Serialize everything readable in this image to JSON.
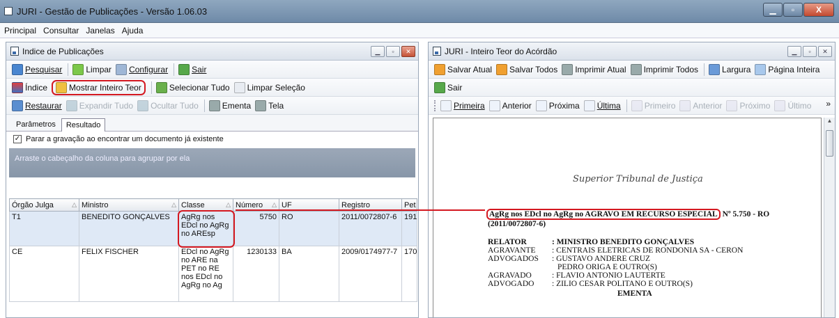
{
  "window": {
    "title": "JURI - Gestão de Publicações - Versão 1.06.03"
  },
  "menu": [
    "Principal",
    "Consultar",
    "Janelas",
    "Ajuda"
  ],
  "left": {
    "title": "Indice de Publicações",
    "toolbar1": [
      "Pesquisar",
      "Limpar",
      "Configurar",
      "Sair"
    ],
    "toolbar2": [
      "Índice",
      "Mostrar Inteiro Teor",
      "Selecionar Tudo",
      "Limpar Seleção"
    ],
    "toolbar3": [
      "Restaurar",
      "Expandir Tudo",
      "Ocultar Tudo",
      "Ementa",
      "Tela"
    ],
    "tabs": [
      "Parâmetros",
      "Resultado"
    ],
    "checkbox_label": "Parar a gravação ao encontrar um documento já existente",
    "group_hint": "Arraste o cabeçalho da coluna para agrupar por ela",
    "columns": [
      "Órgão Julga",
      "Ministro",
      "Classe",
      "Número",
      "UF",
      "Registro",
      "Pet"
    ],
    "rows": [
      {
        "orgao": "T1",
        "ministro": "BENEDITO GONÇALVES",
        "classe": "AgRg nos EDcl no AgRg no AREsp",
        "numero": "5750",
        "uf": "RO",
        "registro": "2011/0072807-6",
        "pet": "191"
      },
      {
        "orgao": "CE",
        "ministro": "FELIX FISCHER",
        "classe": "EDcl no AgRg no ARE na PET no RE nos EDcl no AgRg no Ag",
        "numero": "1230133",
        "uf": "BA",
        "registro": "2009/0174977-7",
        "pet": "170"
      }
    ]
  },
  "right": {
    "title": "JURI - Inteiro Teor do Acórdão",
    "toolbar1": [
      "Salvar Atual",
      "Salvar Todos",
      "Imprimir Atual",
      "Imprimir Todos",
      "Largura",
      "Página Inteira"
    ],
    "toolbar2": [
      "Sair"
    ],
    "toolbar3": [
      "Primeira",
      "Anterior",
      "Próxima",
      "Última",
      "Primeiro",
      "Anterior",
      "Próximo",
      "Último"
    ],
    "chevron": "»",
    "doc": {
      "seal": "Superior Tribunal de Justiça",
      "heading": "AgRg nos EDcl no AgRg no AGRAVO EM RECURSO ESPECIAL",
      "heading_number": "Nº 5.750 - RO",
      "registro": "(2011/0072807-6)",
      "lines": [
        {
          "label": "RELATOR",
          "value": ": MINISTRO BENEDITO GONÇALVES"
        },
        {
          "label": "AGRAVANTE",
          "value": ": CENTRAIS ELETRICAS DE RONDONIA SA - CERON"
        },
        {
          "label": "ADVOGADOS",
          "value": ": GUSTAVO ANDERE CRUZ"
        },
        {
          "label": "",
          "value": "PEDRO ORIGA E OUTRO(S)"
        },
        {
          "label": "AGRAVADO",
          "value": ": FLAVIO ANTONIO LAUTERTE"
        },
        {
          "label": "ADVOGADO",
          "value": ": ZILIO CESAR POLITANO E OUTRO(S)"
        }
      ],
      "ementa": "EMENTA"
    }
  },
  "colors": {
    "highlight": "#d41820",
    "titlebar": "#7f99b6"
  }
}
